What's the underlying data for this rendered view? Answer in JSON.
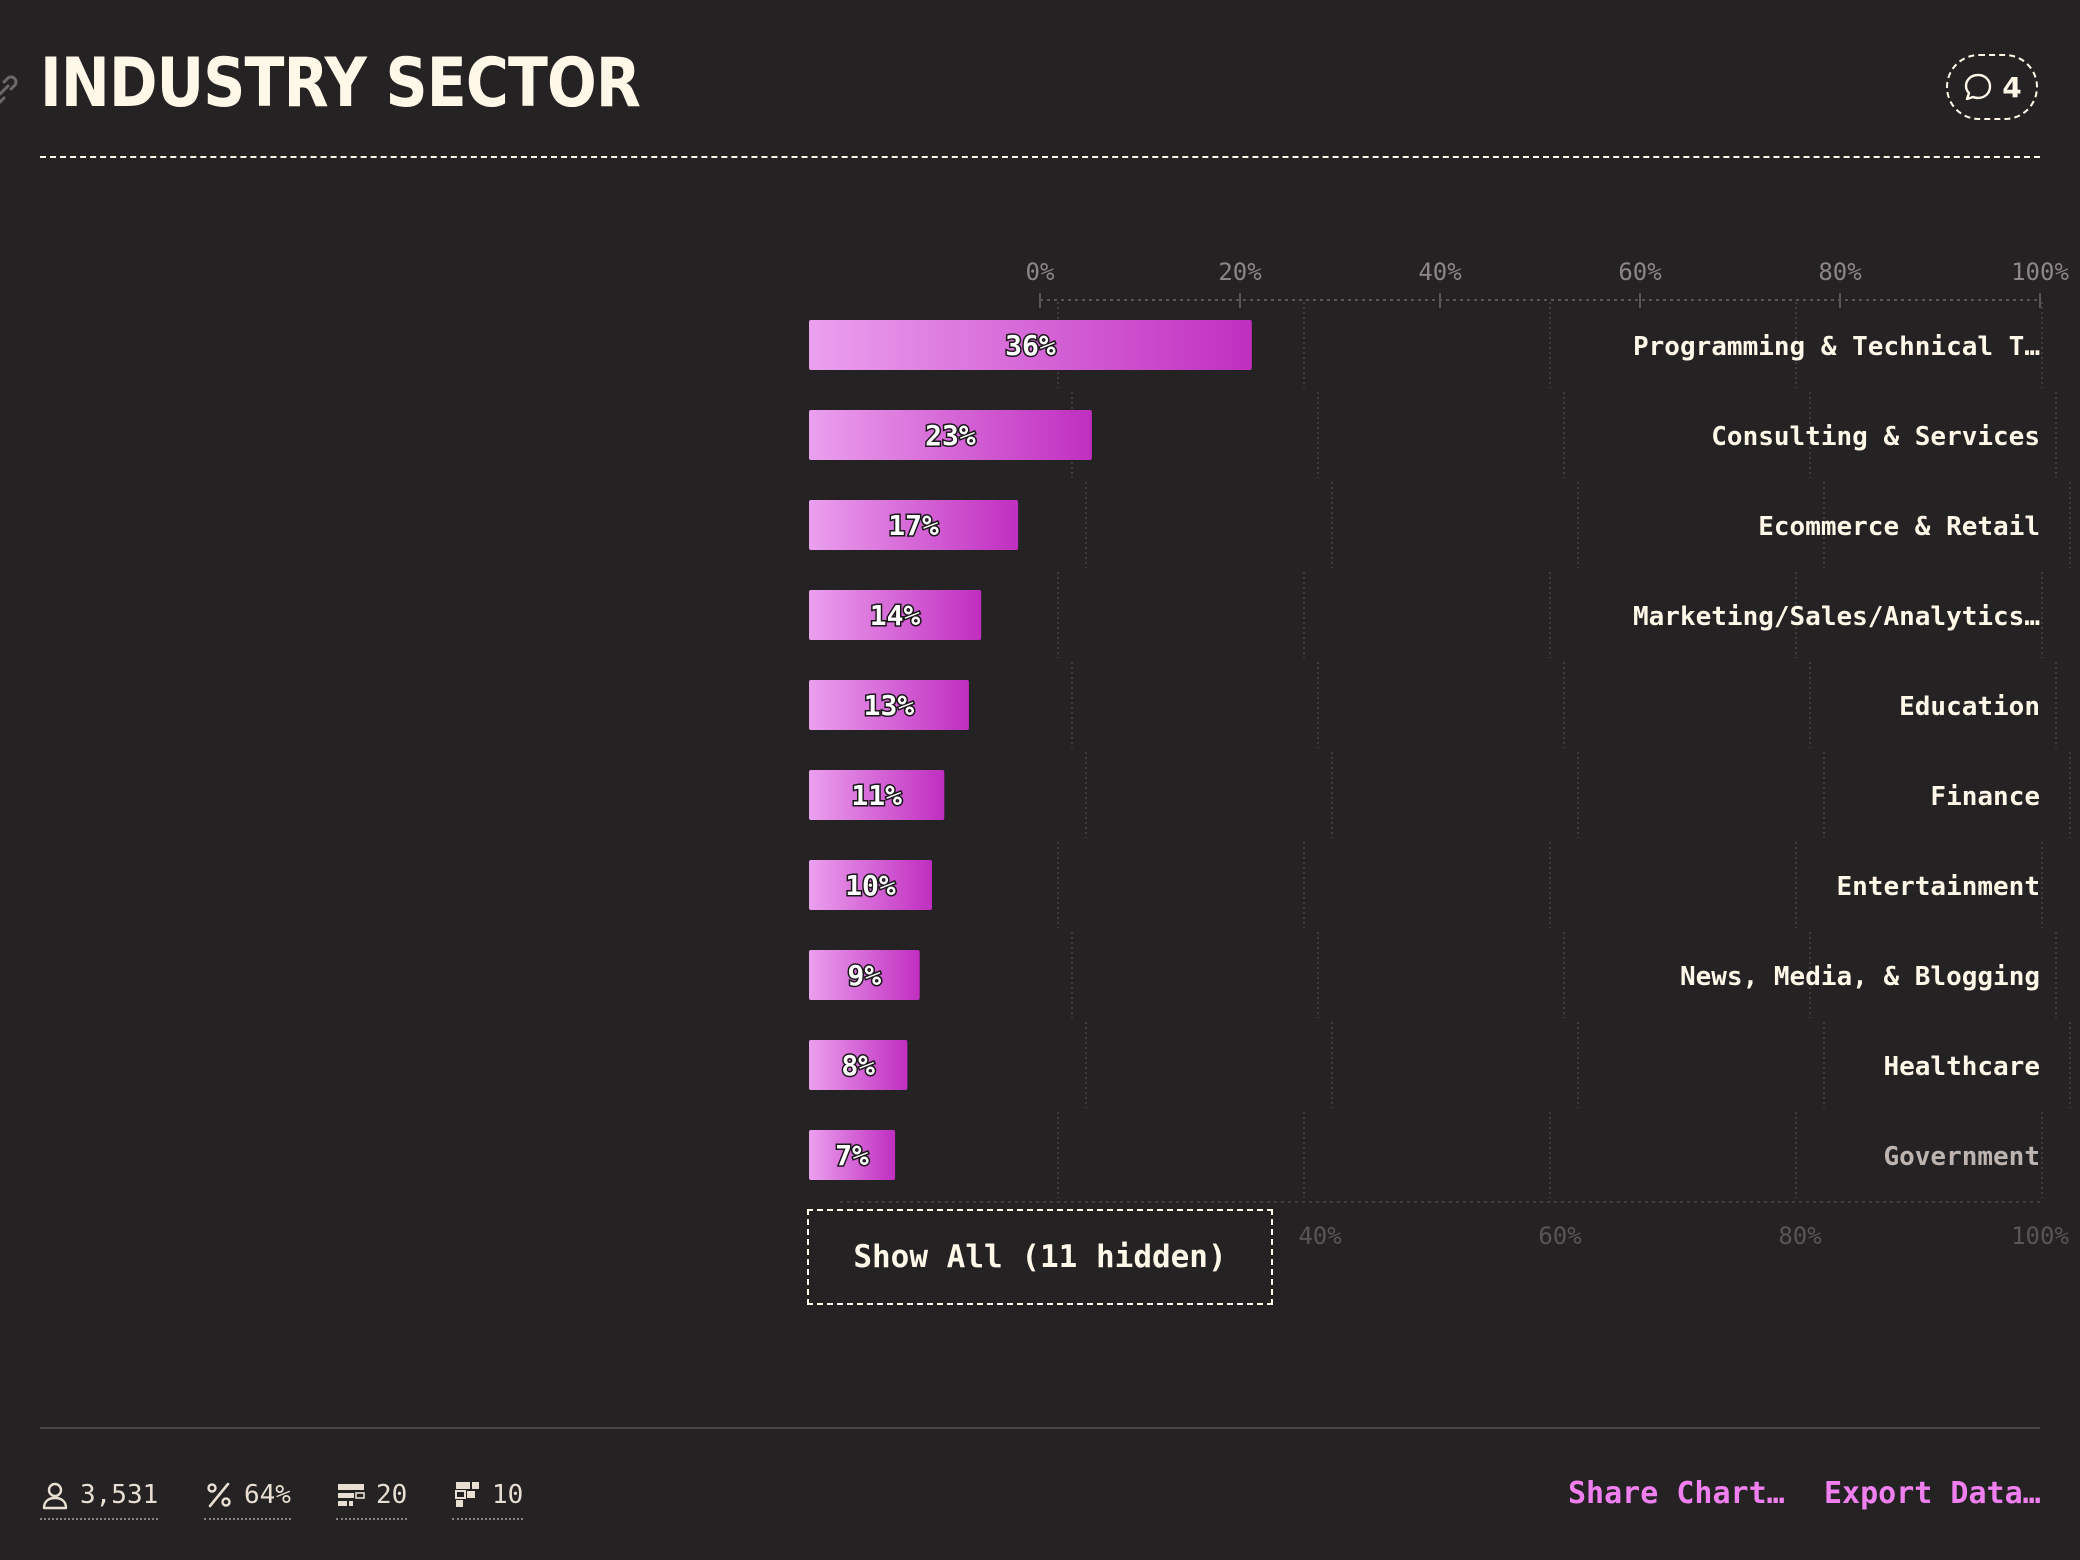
{
  "header": {
    "title": "INDUSTRY SECTOR",
    "comment_count": "4"
  },
  "chart_data": {
    "type": "bar",
    "orientation": "horizontal",
    "xlim": [
      0,
      100
    ],
    "xticks": [
      "0%",
      "20%",
      "40%",
      "60%",
      "80%",
      "100%"
    ],
    "categories": [
      "Programming & Technical T…",
      "Consulting & Services",
      "Ecommerce & Retail",
      "Marketing/Sales/Analytics…",
      "Education",
      "Finance",
      "Entertainment",
      "News, Media, & Blogging",
      "Healthcare",
      "Government"
    ],
    "values": [
      36,
      23,
      17,
      14,
      13,
      11,
      10,
      9,
      8,
      7
    ],
    "labels": [
      "36%",
      "23%",
      "17%",
      "14%",
      "13%",
      "11%",
      "10%",
      "9%",
      "8%",
      "7%"
    ],
    "bar_color_start": "#eba0ee",
    "bar_color_end": "#c02ec0",
    "grid": true
  },
  "show_all_label": "Show All (11 hidden)",
  "footer": {
    "respondents": "3,531",
    "percent": "64%",
    "options": "20",
    "shown": "10",
    "share_label": "Share Chart…",
    "export_label": "Export Data…"
  }
}
